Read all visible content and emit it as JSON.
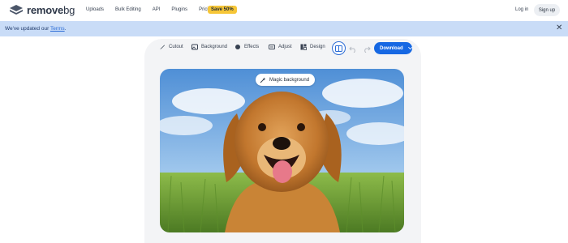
{
  "brand": {
    "name": "remove",
    "name_suffix": "bg"
  },
  "nav": {
    "links": [
      "Uploads",
      "Bulk Editing",
      "API",
      "Plugins",
      "Pricing"
    ],
    "promo_badge": "Save 50%",
    "login_label": "Log in",
    "signup_label": "Sign up"
  },
  "banner": {
    "text_prefix": "We've updated our ",
    "link_text": "Terms",
    "text_suffix": ".",
    "close_icon": "close-icon",
    "background": "#c9dcf7"
  },
  "toolbar": {
    "tools": [
      {
        "label": "Cutout",
        "icon": "brush-icon"
      },
      {
        "label": "Background",
        "icon": "image-icon"
      },
      {
        "label": "Effects",
        "icon": "sparkle-icon"
      },
      {
        "label": "Adjust",
        "icon": "sliders-icon"
      },
      {
        "label": "Design",
        "icon": "layout-icon"
      }
    ],
    "compare_icon": "compare-icon",
    "undo_icon": "undo-icon",
    "redo_icon": "redo-icon",
    "download_label": "Download",
    "accent": "#1668e3"
  },
  "preview": {
    "badge_label": "Magic background",
    "badge_icon": "magic-wand-icon",
    "image_subject": "golden retriever in grass field under blue sky"
  }
}
